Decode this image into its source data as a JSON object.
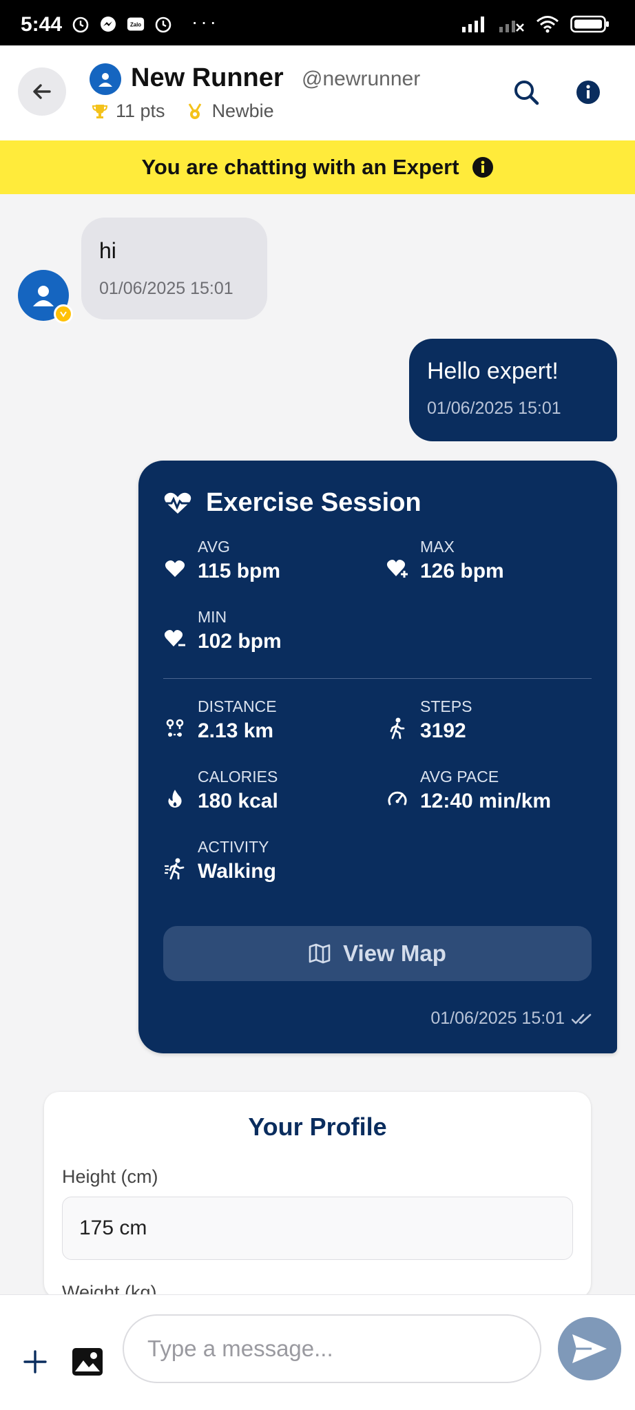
{
  "status_bar": {
    "time": "5:44",
    "dots": "···",
    "icons": [
      "alarm-icon",
      "messenger-icon",
      "zalo-icon",
      "alarm-icon",
      "signal-icon",
      "signal-off-icon",
      "wifi-icon",
      "battery-icon"
    ],
    "zalo_label": "Zalo"
  },
  "header": {
    "name": "New Runner",
    "handle": "@newrunner",
    "points": "11 pts",
    "rank": "Newbie"
  },
  "banner": {
    "text": "You are chatting with an Expert"
  },
  "messages": [
    {
      "direction": "incoming",
      "text": "hi",
      "timestamp": "01/06/2025 15:01"
    },
    {
      "direction": "outgoing",
      "text": "Hello expert!",
      "timestamp": "01/06/2025 15:01"
    }
  ],
  "exercise_session": {
    "title": "Exercise Session",
    "avg_label": "AVG",
    "avg_value": "115 bpm",
    "max_label": "MAX",
    "max_value": "126 bpm",
    "min_label": "MIN",
    "min_value": "102 bpm",
    "distance_label": "DISTANCE",
    "distance_value": "2.13 km",
    "steps_label": "STEPS",
    "steps_value": "3192",
    "calories_label": "CALORIES",
    "calories_value": "180 kcal",
    "pace_label": "AVG PACE",
    "pace_value": "12:40 min/km",
    "activity_label": "ACTIVITY",
    "activity_value": "Walking",
    "view_map_label": "View Map",
    "timestamp": "01/06/2025 15:01"
  },
  "profile": {
    "title": "Your Profile",
    "height_label": "Height (cm)",
    "height_value": "175 cm",
    "weight_label": "Weight (kg)"
  },
  "composer": {
    "placeholder": "Type a message..."
  },
  "colors": {
    "navy": "#0a2d5e",
    "banner_yellow": "#ffeb3b",
    "avatar_blue": "#1565c0",
    "send_button": "#7f99b9"
  }
}
